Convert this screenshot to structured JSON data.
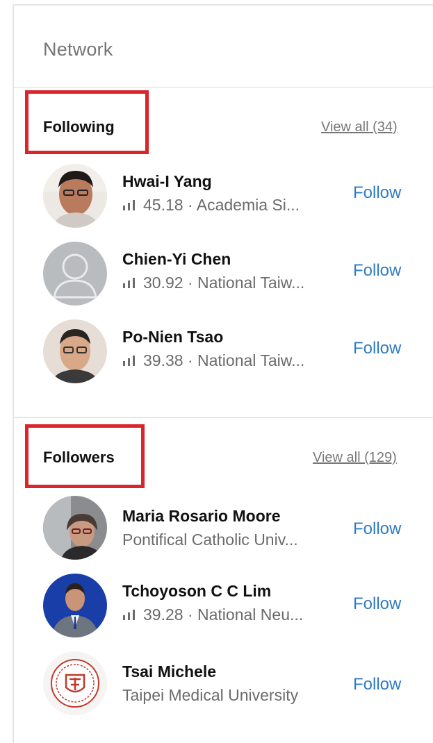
{
  "panel": {
    "title": "Network"
  },
  "following": {
    "title": "Following",
    "view_all": "View all (34)",
    "people": [
      {
        "name": "Hwai-I Yang",
        "score": "45.18",
        "separator": "·",
        "affiliation": "Academia Si...",
        "action": "Follow",
        "avatar": "photo"
      },
      {
        "name": "Chien-Yi Chen",
        "score": "30.92",
        "separator": "·",
        "affiliation": "National Taiw...",
        "action": "Follow",
        "avatar": "placeholder"
      },
      {
        "name": "Po-Nien Tsao",
        "score": "39.38",
        "separator": "·",
        "affiliation": "National Taiw...",
        "action": "Follow",
        "avatar": "photo"
      }
    ]
  },
  "followers": {
    "title": "Followers",
    "view_all": "View all (129)",
    "people": [
      {
        "name": "Maria Rosario Moore",
        "affiliation": "Pontifical Catholic Univ...",
        "action": "Follow",
        "avatar": "photo"
      },
      {
        "name": "Tchoyoson C C Lim",
        "score": "39.28",
        "separator": "·",
        "affiliation": "National Neu...",
        "action": "Follow",
        "avatar": "photo"
      },
      {
        "name": "Tsai Michele",
        "affiliation": "Taipei Medical University",
        "action": "Follow",
        "avatar": "logo"
      }
    ]
  },
  "colors": {
    "link": "#2f7cc4",
    "highlight_box": "#d9262b",
    "muted_text": "#6b6b6b"
  },
  "icons": {
    "score": "signal-bars-icon"
  }
}
